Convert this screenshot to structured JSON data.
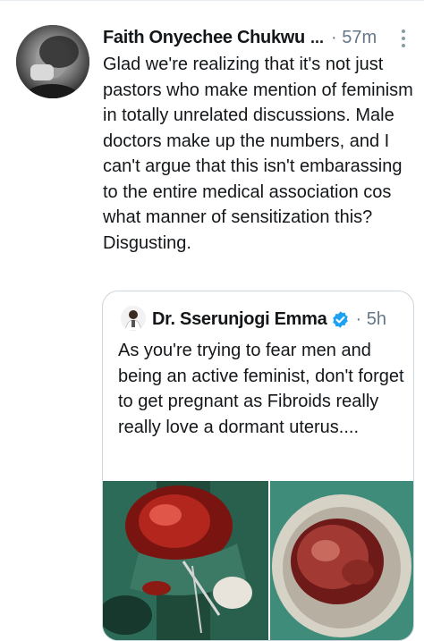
{
  "tweet": {
    "author_name": "Faith Onyechee Chukwu",
    "name_ellipsis": "...",
    "meta": "· 57m",
    "text": "Glad we're realizing that it's not just pastors who make mention of feminism in totally unrelated discussions. Male doctors make up the numbers, and I can't argue that this isn't embarassing to the entire medical association cos what manner of sensitization this? Disgusting.",
    "menu_icon": "more-vertical-icon"
  },
  "quoted": {
    "author_name": "Dr. Sserunjogi Emma",
    "verified_icon": "verified-badge-icon",
    "meta": "· 5h",
    "text": "As you're trying to fear men and being an active feminist, don't forget to get pregnant as Fibroids really really love a dormant uterus....",
    "images": [
      "surgery-photo",
      "fibroid-specimen-photo"
    ]
  },
  "colors": {
    "text": "#14171a",
    "secondary": "#657786",
    "verified": "#1da1f2",
    "border": "#ccd6dd"
  }
}
